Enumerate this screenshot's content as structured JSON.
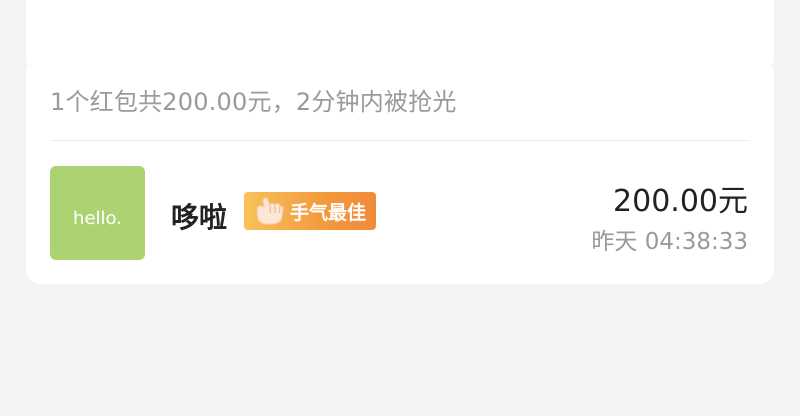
{
  "summary": "1个红包共200.00元，2分钟内被抢光",
  "records": [
    {
      "avatar_text": "hello.",
      "avatar_color": "#acd272",
      "name": "哆啦",
      "badge_label": "手气最佳",
      "badge_icon": "thumbs-up-hand-icon",
      "amount": "200.00元",
      "time": "昨天 04:38:33"
    }
  ]
}
